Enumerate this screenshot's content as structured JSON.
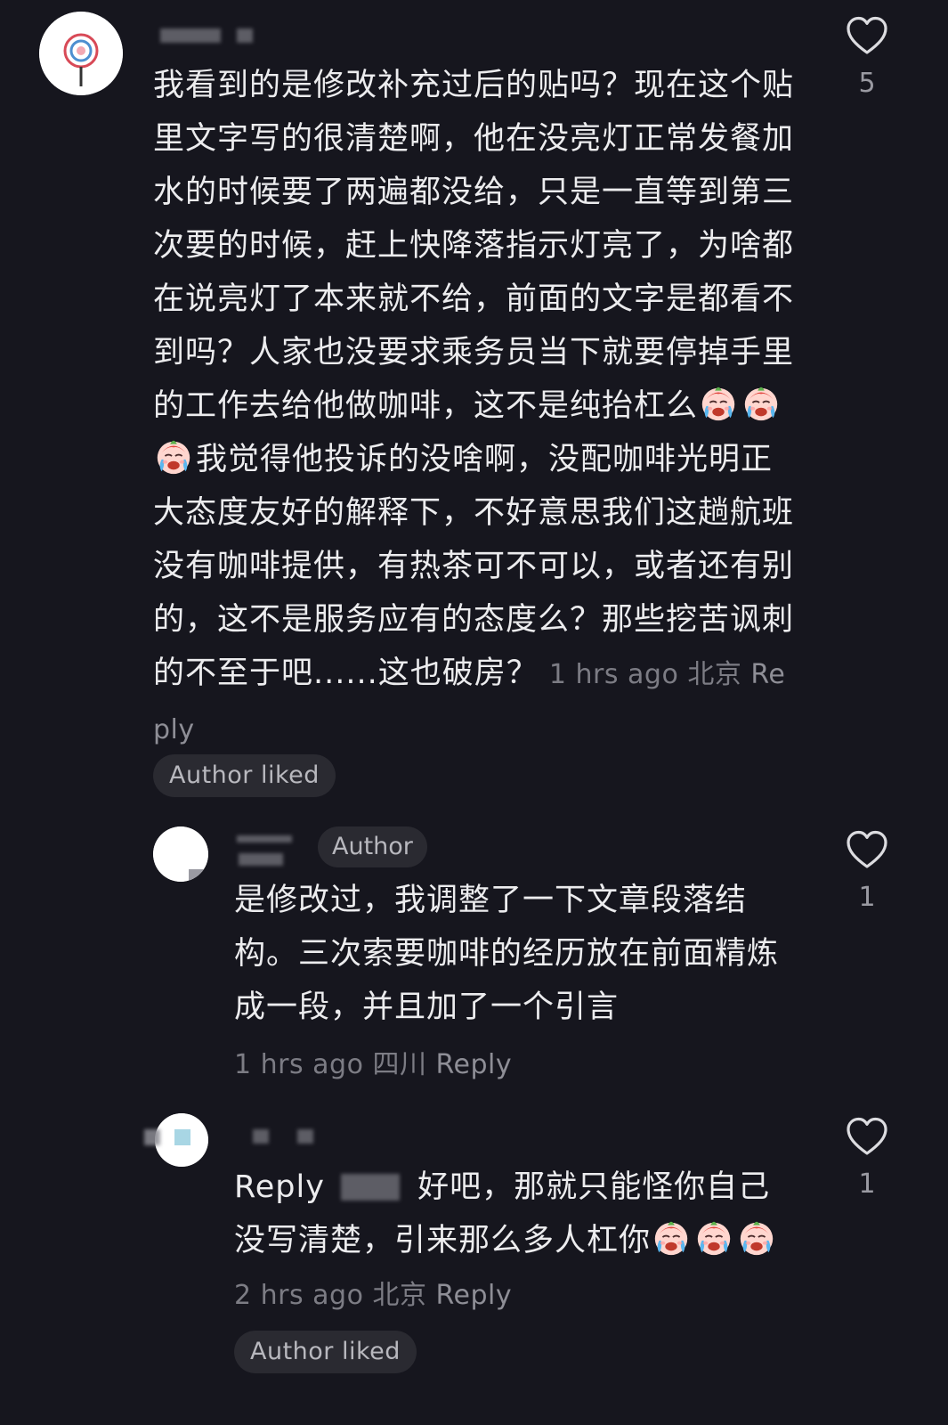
{
  "comments": [
    {
      "text_before_emoji": "我看到的是修改补充过后的贴吗？现在这个贴里文字写的很清楚啊，他在没亮灯正常发餐加水的时候要了两遍都没给，只是一直等到第三次要的时候，赶上快降落指示灯亮了，为啥都在说亮灯了本来就不给，前面的文字是都看不到吗？人家也没要求乘务员当下就要停掉手里的工作去给他做咖啡，这不是纯抬杠么",
      "text_after_emoji": "我觉得他投诉的没啥啊，没配咖啡光明正大态度友好的解释下，不好意思我们这趟航班没有咖啡提供，有热茶可不可以，或者还有别的，这不是服务应有的态度么？那些挖苦讽刺的不至于吧......这也破房？",
      "time": "1 hrs ago",
      "location": "北京",
      "reply_label": "Reply",
      "author_liked": "Author liked",
      "likes": "5",
      "emoji_icon": "crying-face-icon"
    },
    {
      "author_badge": "Author",
      "text": "是修改过，我调整了一下文章段落结构。三次索要咖啡的经历放在前面精炼成一段，并且加了一个引言",
      "time": "1 hrs ago",
      "location": "四川",
      "reply_label": "Reply",
      "likes": "1"
    },
    {
      "reply_prefix": "Reply",
      "text": "好吧，那就只能怪你自己没写清楚，引来那么多人杠你",
      "time": "2 hrs ago",
      "location": "北京",
      "reply_label": "Reply",
      "author_liked": "Author liked",
      "likes": "1",
      "emoji_icon": "crying-face-icon"
    }
  ],
  "colors": {
    "background": "#16161e",
    "text": "#ececee",
    "meta": "#7c7c84",
    "chip_bg": "#2a2a31"
  },
  "icons": {
    "like": "heart-outline-icon"
  }
}
